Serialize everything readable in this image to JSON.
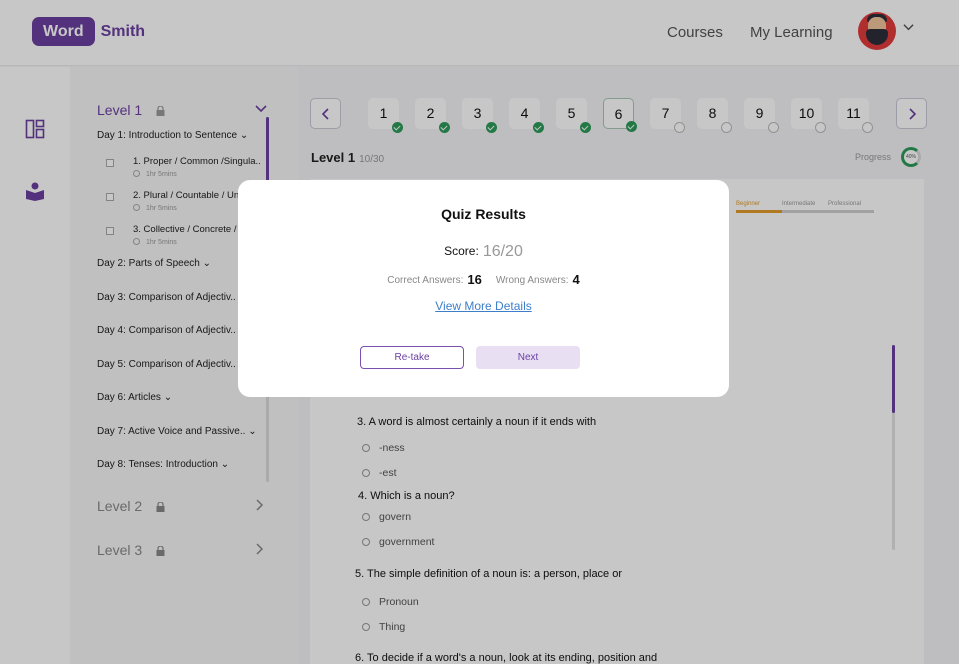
{
  "header": {
    "logo_word": "Word",
    "logo_smith": "Smith",
    "nav": [
      "Courses",
      "My Learning"
    ]
  },
  "sidebar": {
    "levels": [
      {
        "label": "Level 1",
        "expanded": true
      },
      {
        "label": "Level 2",
        "locked": true
      },
      {
        "label": "Level 3",
        "locked": true
      }
    ],
    "days": [
      "Day 1: Introduction to Sentence",
      "Day 2: Parts of Speech",
      "Day 3: Comparison of Adjectiv..",
      "Day 4: Comparison of Adjectiv..",
      "Day 5: Comparison of Adjectiv..",
      "Day 6: Articles",
      "Day 7: Active Voice and Passive..",
      "Day 8: Tenses: Introduction"
    ],
    "lessons": [
      {
        "title": "1. Proper / Common /Singula..",
        "duration": "1hr 5mins"
      },
      {
        "title": "2. Plural / Countable / Un",
        "duration": "1hr 5mins"
      },
      {
        "title": "3. Collective / Concrete /",
        "duration": "1hr 5mins"
      }
    ]
  },
  "main": {
    "question_numbers": [
      {
        "n": "1",
        "done": true
      },
      {
        "n": "2",
        "done": true
      },
      {
        "n": "3",
        "done": true
      },
      {
        "n": "4",
        "done": true
      },
      {
        "n": "5",
        "done": true
      },
      {
        "n": "6",
        "done": true,
        "current": true
      },
      {
        "n": "7",
        "done": false
      },
      {
        "n": "8",
        "done": false
      },
      {
        "n": "9",
        "done": false
      },
      {
        "n": "10",
        "done": false
      },
      {
        "n": "11",
        "done": false
      }
    ],
    "level_title": "Level 1",
    "level_count": "10/30",
    "progress_label": "Progress",
    "progress_value": "40%",
    "progress_fraction": 0.4,
    "tabs": [
      "Beginner",
      "Intermediate",
      "Professional"
    ],
    "questions": [
      {
        "q": "3. A word is almost certainly a noun if it ends with",
        "options": [
          "-ness",
          "-est"
        ]
      },
      {
        "q": "4. Which is a noun?",
        "options": [
          "govern",
          "government"
        ]
      },
      {
        "q": "5. The simple definition of a noun is: a person, place or",
        "options": [
          "Pronoun",
          "Thing"
        ]
      },
      {
        "q": "6. To decide if a word's a noun, look at its ending, position and",
        "options": []
      }
    ]
  },
  "modal": {
    "title": "Quiz Results",
    "score_label": "Score:",
    "score_value": "16/20",
    "correct_label": "Correct Answers:",
    "correct_value": "16",
    "wrong_label": "Wrong Answers:",
    "wrong_value": "4",
    "details_link": "View More Details",
    "retake_label": "Re-take",
    "next_label": "Next"
  },
  "colors": {
    "brand": "#6b3fa0",
    "success": "#2e9b5a",
    "tab_active": "#e39b2a",
    "link": "#3d7ec9"
  }
}
